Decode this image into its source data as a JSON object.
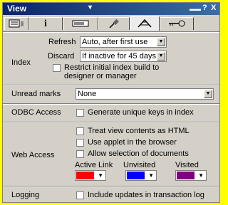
{
  "window": {
    "title": "View",
    "title_menu_glyph": "▾",
    "title_buttons": [
      "▬▬",
      "?",
      "X"
    ]
  },
  "tabs": [
    {
      "name": "basics",
      "icon": "form-icon"
    },
    {
      "name": "info",
      "icon": "info-icon"
    },
    {
      "name": "design",
      "icon": "design-icon"
    },
    {
      "name": "pin",
      "icon": "pin-icon"
    },
    {
      "name": "index",
      "icon": "index-icon",
      "selected": true
    },
    {
      "name": "security",
      "icon": "key-icon"
    }
  ],
  "index": {
    "label": "Index",
    "refresh_label": "Refresh",
    "refresh_value": "Auto, after first use",
    "discard_label": "Discard",
    "discard_value": "If inactive for 45 days",
    "restrict_label": "Restrict initial index build to designer or manager"
  },
  "unread": {
    "label": "Unread marks",
    "value": "None"
  },
  "odbc": {
    "label": "ODBC Access",
    "option": "Generate unique keys in index"
  },
  "web": {
    "label": "Web Access",
    "options": [
      "Treat view contents as HTML",
      "Use applet in the browser",
      "Allow selection of documents"
    ],
    "colors": [
      {
        "label": "Active Link",
        "color": "#ff0000"
      },
      {
        "label": "Unvisited",
        "color": "#0000ff"
      },
      {
        "label": "Visited",
        "color": "#800080"
      }
    ]
  },
  "logging": {
    "label": "Logging",
    "option": "Include updates in transaction log"
  },
  "colors": {
    "background": "#ffff00",
    "titlebar": "#0a246a",
    "panel": "#d4d0c8"
  }
}
